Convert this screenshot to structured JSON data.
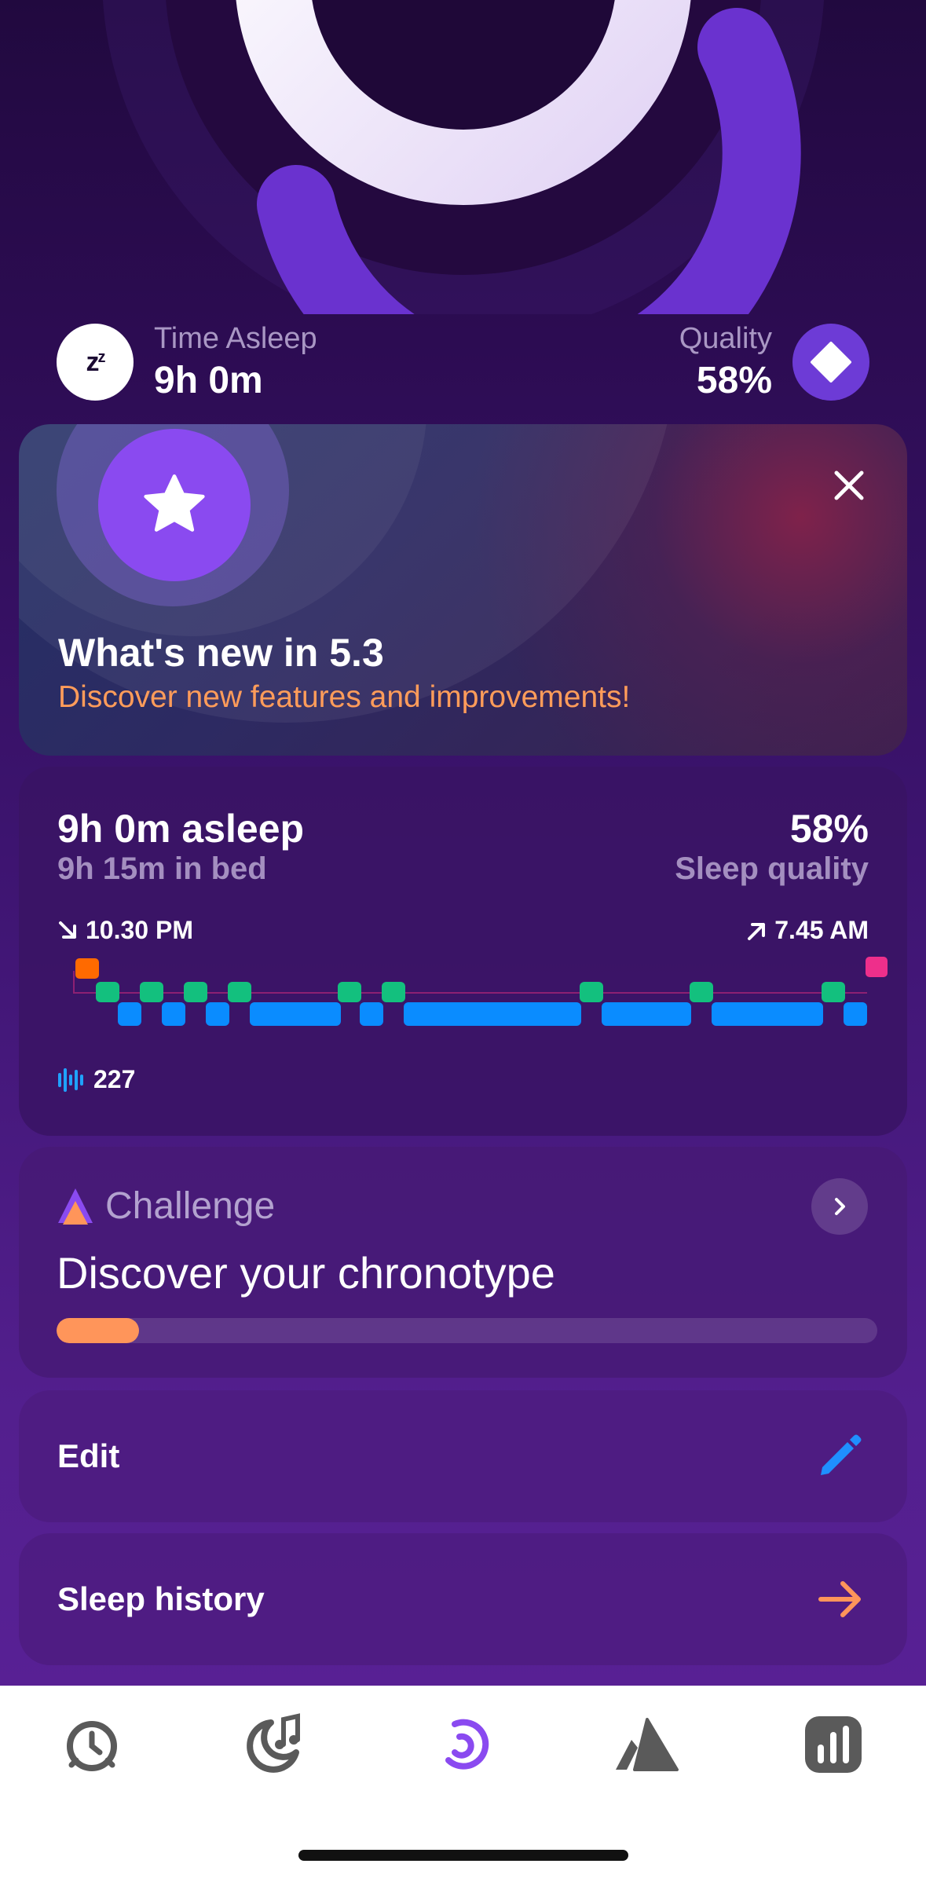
{
  "summary": {
    "time_asleep_label": "Time Asleep",
    "time_asleep_value": "9h 0m",
    "quality_label": "Quality",
    "quality_value": "58%",
    "zz_icon": "zz-icon"
  },
  "whats_new": {
    "title": "What's new in 5.3",
    "subtitle": "Discover new features and improvements!"
  },
  "sleep": {
    "asleep": "9h 0m asleep",
    "in_bed": "9h 15m in bed",
    "quality": "58%",
    "quality_label": "Sleep quality",
    "bedtime": "10.30 PM",
    "wake": "7.45 AM",
    "snore_count": "227",
    "colors": {
      "awake": "#ff6a00",
      "light": "#13c07e",
      "deep": "#0a8cff",
      "end": "#ee2f8b"
    }
  },
  "challenge": {
    "label": "Challenge",
    "title": "Discover your chronotype",
    "progress": 0.1
  },
  "rows": {
    "edit_label": "Edit",
    "history_label": "Sleep history"
  },
  "tabs": [
    "alarm-clock-icon",
    "moon-music-icon",
    "sleep-ring-icon",
    "mountain-icon",
    "stats-icon"
  ],
  "accent": "#8a4af0"
}
